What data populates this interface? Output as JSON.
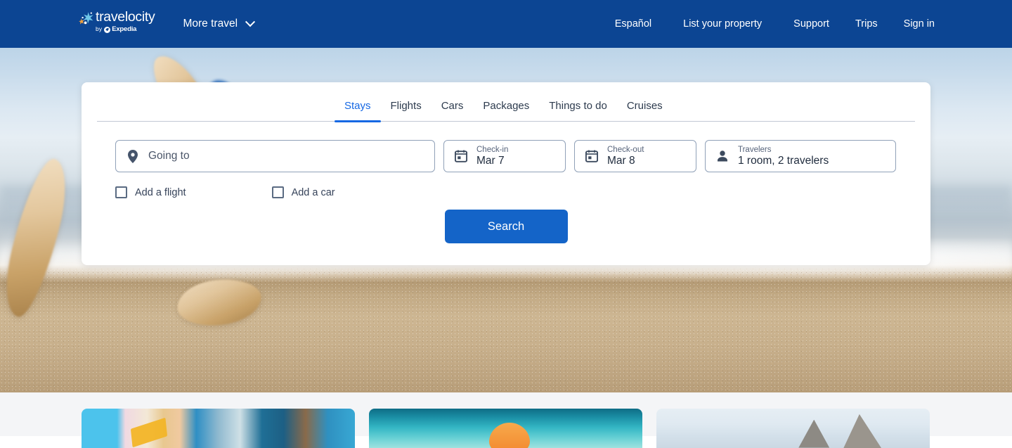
{
  "header": {
    "brand": {
      "word": "travelocity",
      "by": "by",
      "expedia": "Expedia",
      "logo_icon": "starfish-icon"
    },
    "more_travel": {
      "label": "More travel",
      "chevron_icon": "chevron-down-icon"
    },
    "nav_links": [
      {
        "label": "Español"
      },
      {
        "label": "List your property"
      },
      {
        "label": "Support"
      },
      {
        "label": "Trips"
      },
      {
        "label": "Sign in"
      }
    ],
    "background_color": "#0c4593"
  },
  "hero": {
    "image_description": "Beach scene with starfish on sand and ocean waves"
  },
  "search_card": {
    "tabs": [
      {
        "label": "Stays",
        "active": true
      },
      {
        "label": "Flights",
        "active": false
      },
      {
        "label": "Cars",
        "active": false
      },
      {
        "label": "Packages",
        "active": false
      },
      {
        "label": "Things to do",
        "active": false
      },
      {
        "label": "Cruises",
        "active": false
      }
    ],
    "active_tab_color": "#1668e3",
    "destination": {
      "icon": "map-pin-icon",
      "placeholder": "Going to",
      "value": ""
    },
    "check_in": {
      "icon": "calendar-icon",
      "label": "Check-in",
      "value": "Mar 7"
    },
    "check_out": {
      "icon": "calendar-icon",
      "label": "Check-out",
      "value": "Mar 8"
    },
    "travelers": {
      "icon": "person-icon",
      "label": "Travelers",
      "value": "1 room, 2 travelers"
    },
    "checkboxes": [
      {
        "label": "Add a flight",
        "checked": false
      },
      {
        "label": "Add a car",
        "checked": false
      }
    ],
    "search_button": {
      "label": "Search",
      "color": "#1464c8"
    }
  },
  "promo_strip": {
    "background_color": "#f4f5f7",
    "cards": [
      {
        "image_description": "Colorful beach huts and building facades"
      },
      {
        "image_description": "Swimming pool with orange inflatable float"
      },
      {
        "image_description": "Rocky mountain peaks against pale sky"
      }
    ]
  }
}
